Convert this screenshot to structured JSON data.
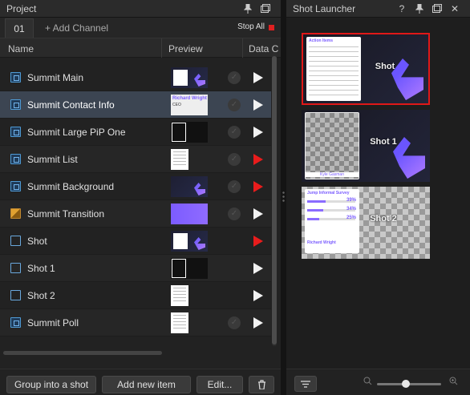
{
  "project_panel": {
    "title": "Project",
    "tab_label": "01",
    "add_channel": "+ Add Channel",
    "stop_all": "Stop All",
    "columns": {
      "name": "Name",
      "preview": "Preview",
      "data": "Data C"
    },
    "items": [
      {
        "name": "Summit Main",
        "icon": "graphic",
        "thumb": "dark-card",
        "check": true,
        "live": false
      },
      {
        "name": "Summit Contact Info",
        "icon": "graphic",
        "thumb": "lower-third",
        "check": true,
        "live": false,
        "selected": true
      },
      {
        "name": "Summit Large PiP One",
        "icon": "graphic",
        "thumb": "white-frame",
        "check": true,
        "live": false
      },
      {
        "name": "Summit List",
        "icon": "graphic",
        "thumb": "list",
        "check": true,
        "live": true
      },
      {
        "name": "Summit Background",
        "icon": "graphic",
        "thumb": "background",
        "check": true,
        "live": true
      },
      {
        "name": "Summit Transition",
        "icon": "transition",
        "thumb": "purple",
        "check": true,
        "live": false
      },
      {
        "name": "Shot",
        "icon": "shot",
        "thumb": "dark-card",
        "check": false,
        "live": true
      },
      {
        "name": "Shot 1",
        "icon": "shot",
        "thumb": "white-frame",
        "check": false,
        "live": false
      },
      {
        "name": "Shot 2",
        "icon": "shot",
        "thumb": "list",
        "check": false,
        "live": false
      },
      {
        "name": "Summit Poll",
        "icon": "graphic",
        "thumb": "list",
        "check": true,
        "live": false
      }
    ],
    "buttons": {
      "group": "Group into a shot",
      "add": "Add new item",
      "edit": "Edit..."
    }
  },
  "shot_launcher": {
    "title": "Shot Launcher",
    "shots": [
      {
        "label": "Shot",
        "card_title": "Action Items"
      },
      {
        "label": "Shot 1",
        "card_name": "Kyle Gasman"
      },
      {
        "label": "Shot 2",
        "card_title": "Jump Informal Survey",
        "percents": [
          "39%",
          "34%",
          "25%"
        ],
        "card_name": "Richard Wright"
      }
    ],
    "zoom_level": 0.45
  },
  "colors": {
    "live": "#e81c1c",
    "selection": "#3c4552",
    "accent": "#7a5cff"
  },
  "lower_third": {
    "name": "Richard Wright",
    "role": "CEO"
  }
}
